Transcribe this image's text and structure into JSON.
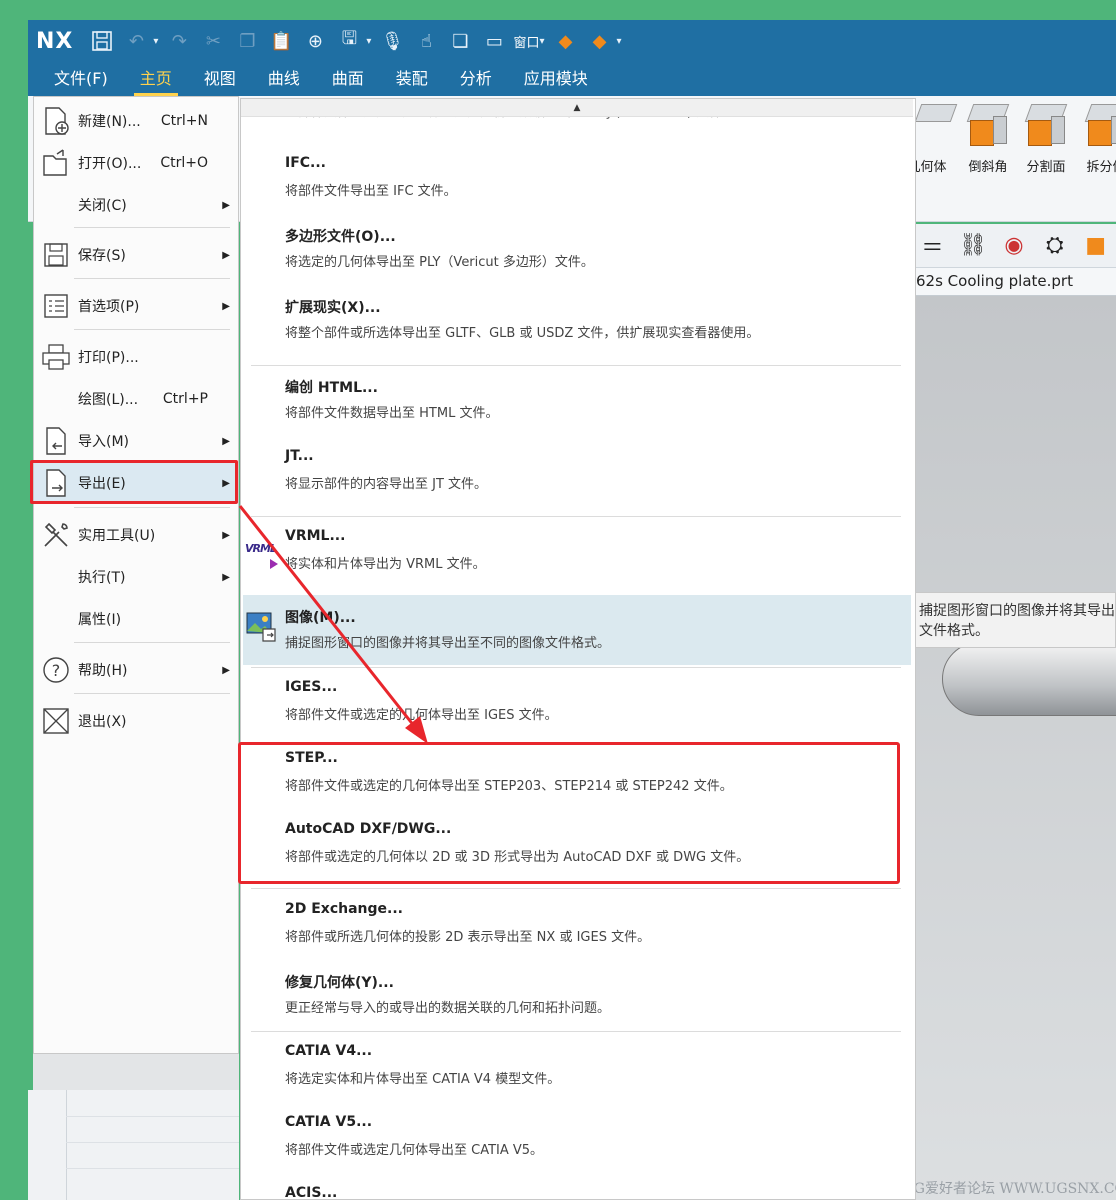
{
  "titlebar": {
    "logo": "NX",
    "window_label": "窗口"
  },
  "tabs": [
    "文件(F)",
    "主页",
    "视图",
    "曲线",
    "曲面",
    "装配",
    "分析",
    "应用模块"
  ],
  "ribbon": {
    "buttons": [
      {
        "label": "几何体"
      },
      {
        "label": "倒斜角"
      },
      {
        "label": "分割面"
      },
      {
        "label": "拆分体"
      }
    ]
  },
  "file_tab": "62s Cooling plate.prt",
  "tooltip": {
    "line1": "捕捉图形窗口的图像并将其导出",
    "line2": "文件格式。"
  },
  "file_menu": {
    "items": [
      {
        "label": "新建(N)...",
        "shortcut": "Ctrl+N",
        "icon": "new-file-icon",
        "arrow": false
      },
      {
        "label": "打开(O)...",
        "shortcut": "Ctrl+O",
        "icon": "open-file-icon",
        "arrow": false
      },
      {
        "label": "关闭(C)",
        "shortcut": "",
        "icon": "",
        "arrow": true
      },
      {
        "label": "保存(S)",
        "shortcut": "",
        "icon": "save-icon",
        "arrow": true
      },
      {
        "label": "首选项(P)",
        "shortcut": "",
        "icon": "preferences-icon",
        "arrow": true
      },
      {
        "label": "打印(P)...",
        "shortcut": "",
        "icon": "print-icon",
        "arrow": false
      },
      {
        "label": "绘图(L)...",
        "shortcut": "Ctrl+P",
        "icon": "",
        "arrow": false
      },
      {
        "label": "导入(M)",
        "shortcut": "",
        "icon": "import-icon",
        "arrow": true
      },
      {
        "label": "导出(E)",
        "shortcut": "",
        "icon": "export-icon",
        "arrow": true
      },
      {
        "label": "实用工具(U)",
        "shortcut": "",
        "icon": "tools-icon",
        "arrow": true
      },
      {
        "label": "执行(T)",
        "shortcut": "",
        "icon": "",
        "arrow": true
      },
      {
        "label": "属性(I)",
        "shortcut": "",
        "icon": "",
        "arrow": false
      },
      {
        "label": "帮助(H)",
        "shortcut": "",
        "icon": "help-icon",
        "arrow": true
      },
      {
        "label": "退出(X)",
        "shortcut": "",
        "icon": "exit-icon",
        "arrow": false
      }
    ]
  },
  "export_menu": {
    "partial_top": "将部件文件、选定的几何体或选定分析的数据导出至 OBJ (Wavefront) 文件。",
    "items": [
      {
        "title": "IFC...",
        "desc": "将部件文件导出至 IFC 文件。"
      },
      {
        "title": "多边形文件(O)...",
        "desc": "将选定的几何体导出至 PLY（Vericut 多边形）文件。"
      },
      {
        "title": "扩展现实(X)...",
        "desc": "将整个部件或所选体导出至 GLTF、GLB 或 USDZ 文件，供扩展现实查看器使用。"
      },
      {
        "title": "编创 HTML...",
        "desc": "将部件文件数据导出至 HTML 文件。"
      },
      {
        "title": "JT...",
        "desc": "将显示部件的内容导出至 JT 文件。"
      },
      {
        "title": "VRML...",
        "desc": "将实体和片体导出为 VRML 文件。"
      },
      {
        "title": "图像(M)...",
        "desc": "捕捉图形窗口的图像并将其导出至不同的图像文件格式。"
      },
      {
        "title": "IGES...",
        "desc": "将部件文件或选定的几何体导出至 IGES 文件。"
      },
      {
        "title": "STEP...",
        "desc": "将部件文件或选定的几何体导出至 STEP203、STEP214 或 STEP242 文件。"
      },
      {
        "title": "AutoCAD DXF/DWG...",
        "desc": "将部件或选定的几何体以 2D 或 3D 形式导出为 AutoCAD DXF 或 DWG 文件。"
      },
      {
        "title": "2D Exchange...",
        "desc": "将部件或所选几何体的投影 2D 表示导出至 NX 或 IGES 文件。"
      },
      {
        "title": "修复几何体(Y)...",
        "desc": "更正经常与导入的或导出的数据关联的几何和拓扑问题。"
      },
      {
        "title": "CATIA V4...",
        "desc": "将选定实体和片体导出至 CATIA V4 模型文件。"
      },
      {
        "title": "CATIA V5...",
        "desc": "将部件文件或选定几何体导出至 CATIA V5。"
      },
      {
        "title": "ACIS...",
        "desc": ""
      }
    ],
    "vrml_icon_text": "VRML"
  },
  "watermark": "UG爱好者论坛 WWW.UGSNX.COM",
  "colors": {
    "accent_blue": "#1f6fa3",
    "active_tab": "#ffd24d",
    "highlight_red": "#e8262c",
    "highlight_row": "#dbe9f2"
  }
}
